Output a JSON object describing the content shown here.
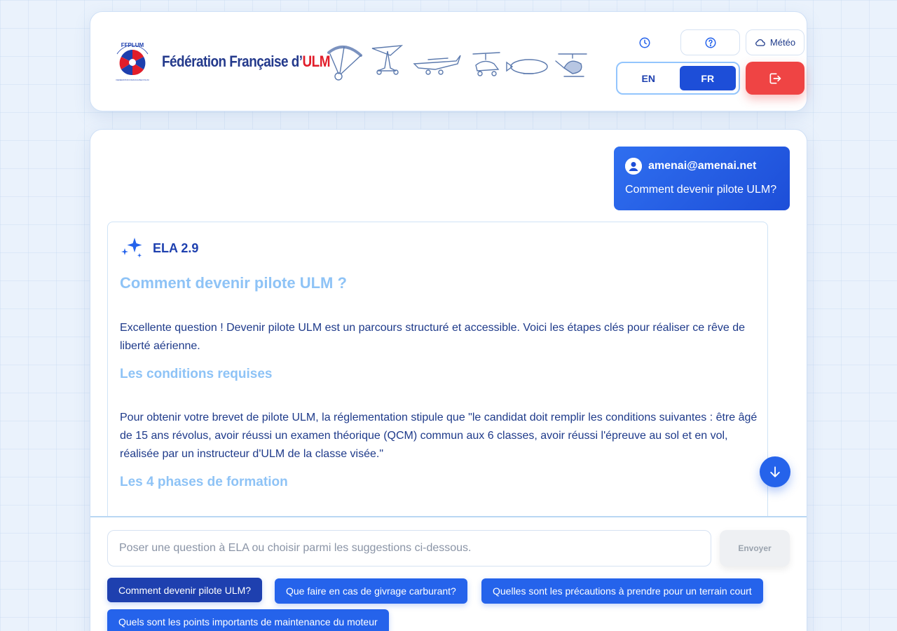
{
  "header": {
    "brand": {
      "name_prefix": "Fédération Française d’",
      "name_accent": "ULM",
      "logo_text": "FFPLUM",
      "logo_sub": "FEDERATION FRANCAISE D'ULM"
    },
    "aircraft_icons": [
      "paramotor-icon",
      "pendulaire-icon",
      "multiaxe-icon",
      "autogire-icon",
      "aerostat-icon",
      "helicoptere-icon"
    ],
    "buttons": {
      "history": "clock-icon",
      "help": "help-icon",
      "meteo": "Météo",
      "logout": "logout-icon"
    },
    "languages": {
      "en": "EN",
      "fr": "FR",
      "selected": "FR"
    }
  },
  "chat": {
    "user_message": {
      "email": "amenai@amenai.net",
      "text": "Comment devenir pilote ULM?"
    },
    "assistant": {
      "name": "ELA 2.9",
      "heading": "Comment devenir pilote ULM ?",
      "intro": "Excellente question ! Devenir pilote ULM est un parcours structuré et accessible. Voici les étapes clés pour réaliser ce rêve de liberté aérienne.",
      "section1_title": "Les conditions requises",
      "section1_text": "Pour obtenir votre brevet de pilote ULM, la réglementation stipule que \"le candidat doit remplir les conditions suivantes : être âgé de 15 ans révolus, avoir réussi un examen théorique (QCM) commun aux 6 classes, avoir réussi l'épreuve au sol et en vol, réalisée par un instructeur d'ULM de la classe visée.\"",
      "section2_title": "Les 4 phases de formation"
    }
  },
  "composer": {
    "placeholder": "Poser une question à ELA ou choisir parmi les suggestions ci-dessous.",
    "send_label": "Envoyer",
    "suggestions": [
      "Comment devenir pilote ULM?",
      "Que faire en cas de givrage carburant?",
      "Quelles sont les précautions à prendre pour un terrain court",
      "Quels sont les points importants de maintenance du moteur"
    ]
  },
  "colors": {
    "primary": "#2563eb",
    "danger": "#ef4444",
    "heading_light": "#8ec3f6",
    "text": "#1e3a8a"
  }
}
